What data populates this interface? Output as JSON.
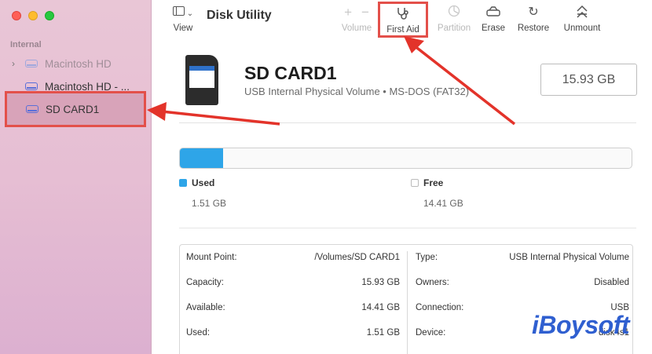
{
  "window": {
    "title": "Disk Utility"
  },
  "toolbar": {
    "view_label": "View",
    "volume_label": "Volume",
    "volume_add": "+",
    "volume_remove": "−",
    "first_aid_label": "First Aid",
    "partition_label": "Partition",
    "erase_label": "Erase",
    "restore_label": "Restore",
    "unmount_label": "Unmount"
  },
  "sidebar": {
    "section": "Internal",
    "items": [
      {
        "label": "Macintosh HD",
        "expandable": true,
        "dimmed": true
      },
      {
        "label": "Macintosh HD - ...",
        "expandable": false,
        "dimmed": false
      },
      {
        "label": "SD CARD1",
        "expandable": false,
        "dimmed": false,
        "selected": true
      }
    ]
  },
  "volume": {
    "name": "SD CARD1",
    "description": "USB Internal Physical Volume • MS-DOS (FAT32)",
    "capacity_badge": "15.93 GB"
  },
  "usage": {
    "used_fraction": 0.095,
    "used_label": "Used",
    "used_value": "1.51 GB",
    "free_label": "Free",
    "free_value": "14.41 GB",
    "used_color": "#2ea5e8"
  },
  "info": {
    "left": [
      {
        "key": "Mount Point:",
        "value": "/Volumes/SD CARD1"
      },
      {
        "key": "Capacity:",
        "value": "15.93 GB"
      },
      {
        "key": "Available:",
        "value": "14.41 GB"
      },
      {
        "key": "Used:",
        "value": "1.51 GB"
      }
    ],
    "right": [
      {
        "key": "Type:",
        "value": "USB Internal Physical Volume"
      },
      {
        "key": "Owners:",
        "value": "Disabled"
      },
      {
        "key": "Connection:",
        "value": "USB"
      },
      {
        "key": "Device:",
        "value": "disk4s1"
      }
    ]
  },
  "annotations": {
    "highlight_color": "#e3504a",
    "watermark": "iBoysoft"
  }
}
